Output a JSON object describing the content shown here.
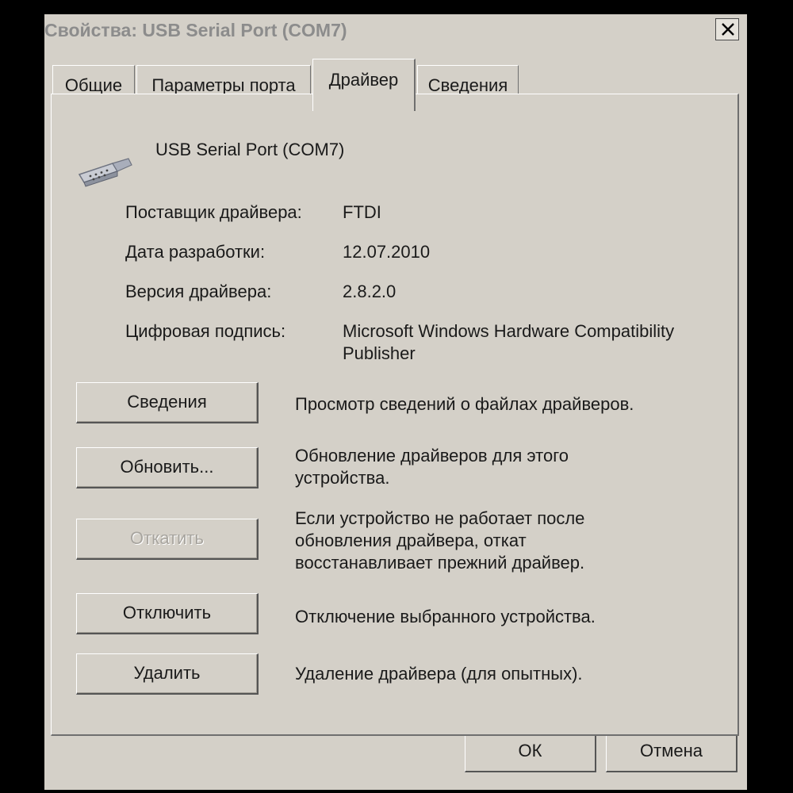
{
  "window": {
    "title": "Свойства: USB Serial Port (COM7)",
    "close_label": "×"
  },
  "tabs": [
    {
      "label": "Общие",
      "active": false
    },
    {
      "label": "Параметры порта",
      "active": false
    },
    {
      "label": "Драйвер",
      "active": true
    },
    {
      "label": "Сведения",
      "active": false
    }
  ],
  "device": {
    "name": "USB Serial Port (COM7)",
    "icon": "serial-port-connector-icon"
  },
  "properties": [
    {
      "label": "Поставщик драйвера:",
      "value": "FTDI"
    },
    {
      "label": "Дата разработки:",
      "value": "12.07.2010"
    },
    {
      "label": "Версия драйвера:",
      "value": "2.8.2.0"
    },
    {
      "label": "Цифровая подпись:",
      "value": "Microsoft Windows Hardware Compatibility Publisher"
    }
  ],
  "actions": [
    {
      "label": "Сведения",
      "description": "Просмотр сведений о файлах драйверов.",
      "enabled": true
    },
    {
      "label": "Обновить...",
      "description": "Обновление драйверов для этого устройства.",
      "enabled": true
    },
    {
      "label": "Откатить",
      "description": "Если устройство не работает после обновления драйвера, откат восстанавливает прежний драйвер.",
      "enabled": false
    },
    {
      "label": "Отключить",
      "description": "Отключение выбранного устройства.",
      "enabled": true
    },
    {
      "label": "Удалить",
      "description": "Удаление драйвера (для опытных).",
      "enabled": true
    }
  ],
  "footer": {
    "ok_label": "ОК",
    "cancel_label": "Отмена"
  },
  "colors": {
    "dialog_bg": "#d4d0c8",
    "title_text": "#8c8c8c",
    "disabled_text": "#a8a59f"
  }
}
